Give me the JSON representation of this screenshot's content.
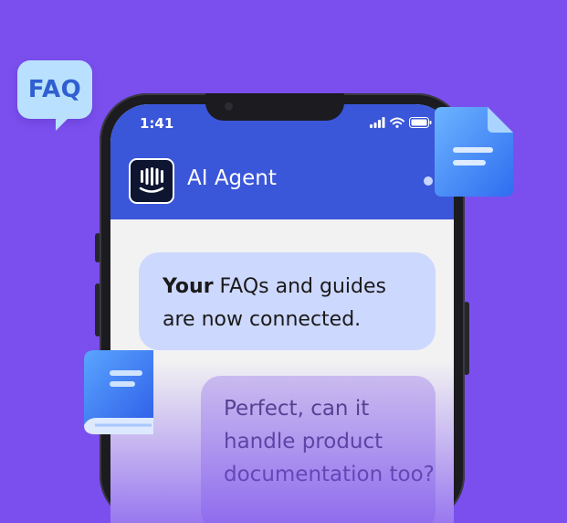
{
  "badge": {
    "label": "FAQ"
  },
  "status_bar": {
    "time": "1:41"
  },
  "header": {
    "title": "AI Agent"
  },
  "messages": [
    {
      "role": "agent",
      "bold_part": "Your",
      "text_rest_line1": " FAQs and guides",
      "text_line2": "are now connected."
    },
    {
      "role": "user",
      "lines": [
        "Perfect, can it",
        "handle product",
        "documentation too?"
      ]
    }
  ],
  "colors": {
    "background": "#7b4fee",
    "header": "#3a56d9",
    "agent_bubble": "#cdd8ff",
    "user_bubble": "#cfc3ef"
  },
  "icons": [
    "faq-chat-icon",
    "document-icon",
    "book-icon",
    "brand-logo-icon",
    "signal-icon",
    "wifi-icon",
    "battery-icon"
  ]
}
